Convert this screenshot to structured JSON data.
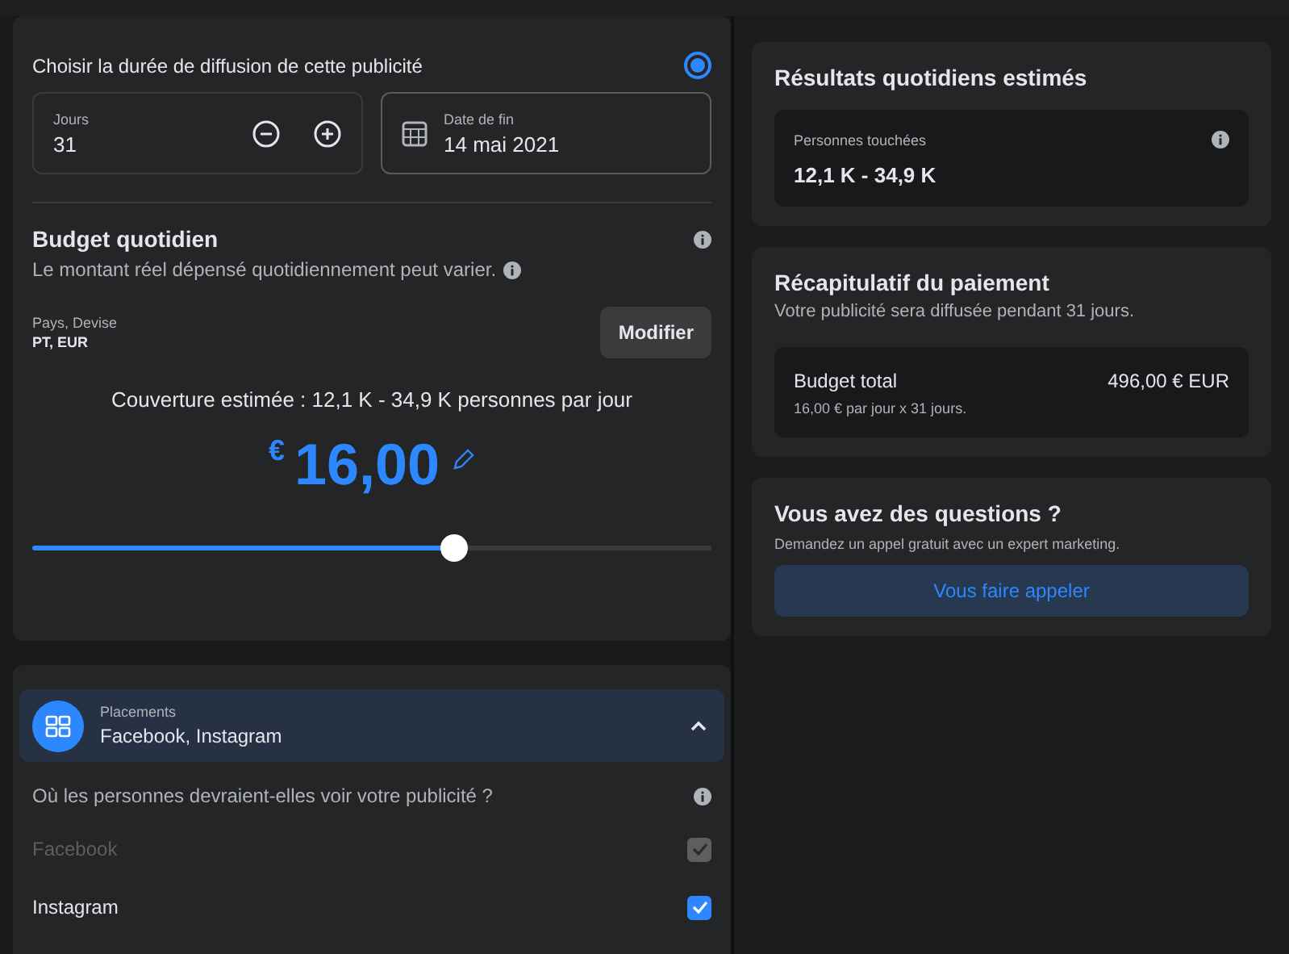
{
  "duration": {
    "label": "Choisir la durée de diffusion de cette publicité",
    "selected": true,
    "days": {
      "label": "Jours",
      "value": "31"
    },
    "end_date": {
      "label": "Date de fin",
      "value": "14 mai 2021"
    }
  },
  "budget": {
    "title": "Budget quotidien",
    "subtitle": "Le montant réel dépensé quotidiennement peut varier.",
    "country_label": "Pays, Devise",
    "country_value": "PT, EUR",
    "edit_button": "Modifier",
    "coverage": "Couverture estimée : 12,1 K - 34,9 K personnes par jour",
    "currency": "€",
    "amount": "16,00",
    "level": 0.62
  },
  "placements": {
    "label": "Placements",
    "value": "Facebook, Instagram",
    "expanded": true,
    "question": "Où les personnes devraient-elles voir votre publicité ?",
    "options": [
      {
        "label": "Facebook",
        "checked": true,
        "disabled": true
      },
      {
        "label": "Instagram",
        "checked": true,
        "disabled": false
      }
    ]
  },
  "results": {
    "title": "Résultats quotidiens estimés",
    "metric_label": "Personnes touchées",
    "metric_value": "12,1 K - 34,9 K"
  },
  "payment": {
    "title": "Récapitulatif du paiement",
    "subtitle": "Votre publicité sera diffusée pendant 31 jours.",
    "total_label": "Budget total",
    "total_value": "496,00 € EUR",
    "total_detail": "16,00 € par jour x 31 jours."
  },
  "help": {
    "title": "Vous avez des questions ?",
    "subtitle": "Demandez un appel gratuit avec un expert marketing.",
    "button": "Vous faire appeler"
  }
}
